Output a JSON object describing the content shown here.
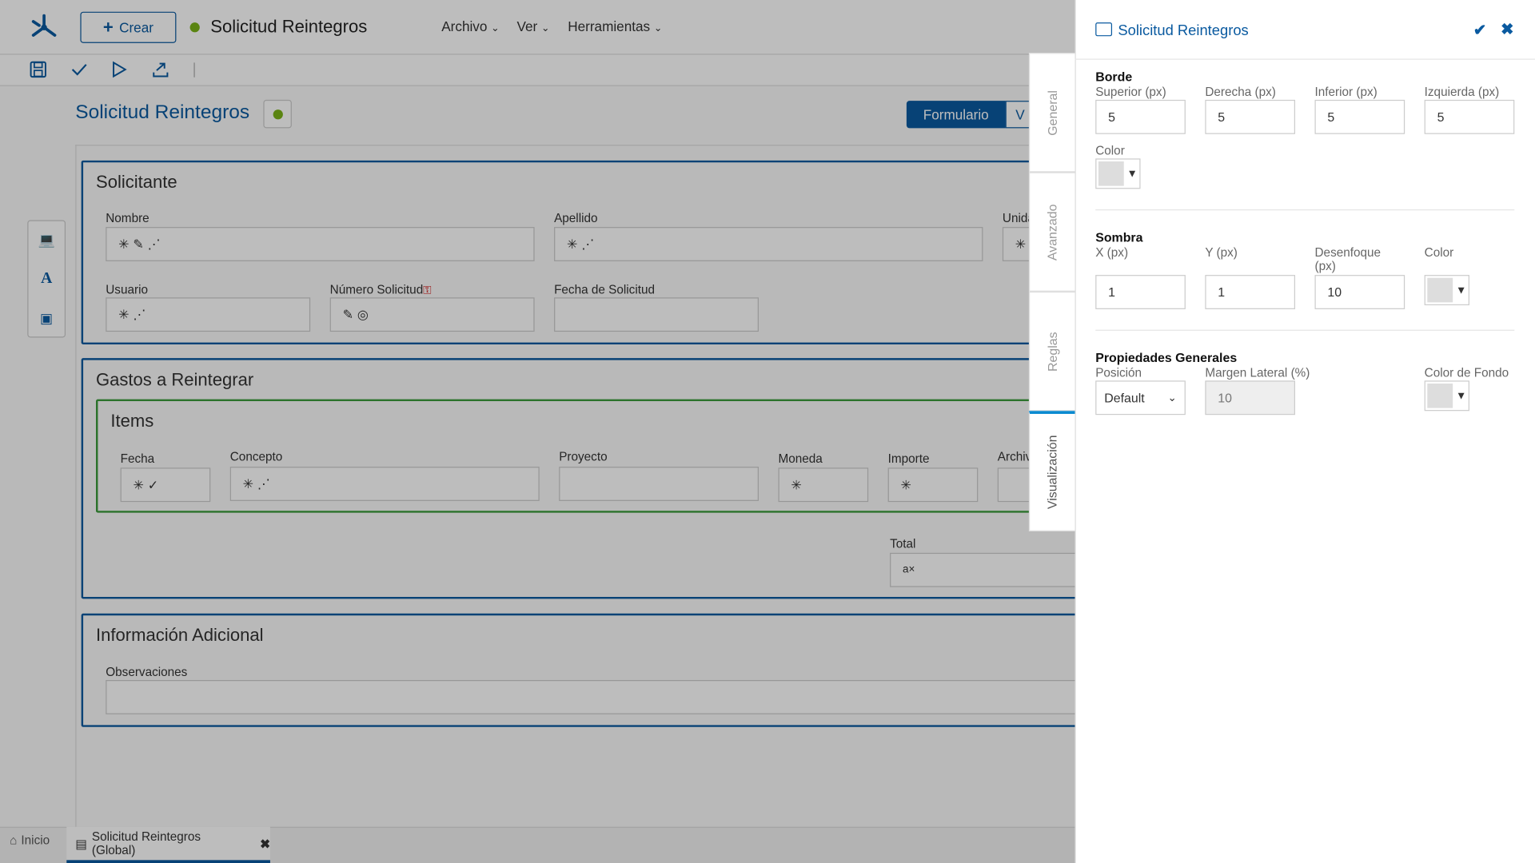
{
  "app": {
    "create_label": "Crear",
    "title": "Solicitud Reintegros",
    "menus": [
      "Archivo",
      "Ver",
      "Herramientas"
    ]
  },
  "page": {
    "title": "Solicitud Reintegros",
    "view_tabs": [
      "Formulario",
      "V"
    ]
  },
  "sections": {
    "solicitante": {
      "title": "Solicitante",
      "fields": {
        "nombre": "Nombre",
        "apellido": "Apellido",
        "unidad": "Unida",
        "usuario": "Usuario",
        "numero": "Número Solicitud",
        "fecha": "Fecha de Solicitud"
      }
    },
    "gastos": {
      "title": "Gastos a Reintegrar",
      "items_title": "Items",
      "cols": [
        "Fecha",
        "Concepto",
        "Proyecto",
        "Moneda",
        "Importe",
        "Archiv"
      ],
      "total": "Total"
    },
    "info": {
      "title": "Información Adicional",
      "obs": "Observaciones"
    }
  },
  "side_tabs": [
    "General",
    "Avanzado",
    "Reglas",
    "Visualización"
  ],
  "panel": {
    "title": "Solicitud Reintegros",
    "borde": {
      "title": "Borde",
      "labels": [
        "Superior (px)",
        "Derecha (px)",
        "Inferior (px)",
        "Izquierda (px)"
      ],
      "values": [
        "5",
        "5",
        "5",
        "5"
      ],
      "color_label": "Color"
    },
    "sombra": {
      "title": "Sombra",
      "labels": [
        "X (px)",
        "Y (px)",
        "Desenfoque (px)",
        "Color"
      ],
      "values": [
        "1",
        "1",
        "10"
      ]
    },
    "generales": {
      "title": "Propiedades Generales",
      "pos_label": "Posición",
      "pos_value": "Default",
      "margin_label": "Margen Lateral (%)",
      "margin_value": "10",
      "bg_label": "Color de Fondo"
    }
  },
  "bottom": {
    "home": "Inicio",
    "tab": "Solicitud Reintegros (Global)"
  }
}
